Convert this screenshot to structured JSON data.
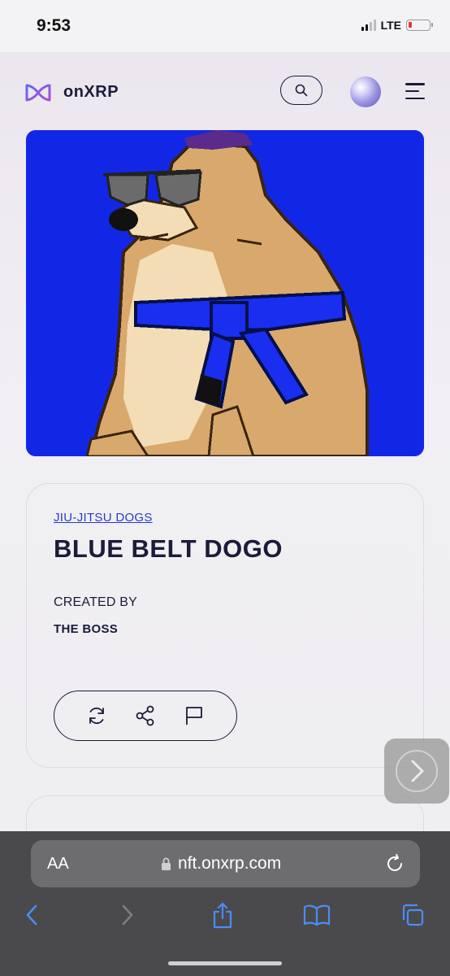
{
  "status_bar": {
    "time": "9:53",
    "network": "LTE"
  },
  "header": {
    "logo_text": "onXRP"
  },
  "nft": {
    "collection": "JIU-JITSU DOGS",
    "title": "BLUE BELT DOGO",
    "created_by_label": "CREATED BY",
    "creator": "THE BOSS"
  },
  "browser": {
    "aa_label": "AA",
    "url": "nft.onxrp.com"
  },
  "colors": {
    "accent": "#1b1b3a",
    "link": "#2a3bd1",
    "image_background": "#1227e6",
    "belt": "#1a2ef0"
  },
  "icons": [
    "search-icon",
    "menu-icon",
    "refresh-icon",
    "share-icon",
    "flag-icon",
    "chevron-right-icon",
    "lock-icon",
    "reload-icon",
    "back-icon",
    "forward-icon",
    "share-upload-icon",
    "bookmarks-icon",
    "tabs-icon"
  ]
}
